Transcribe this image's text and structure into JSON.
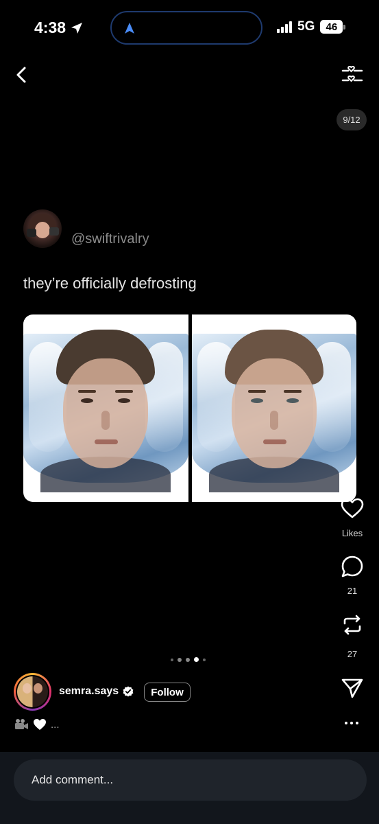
{
  "status_bar": {
    "time": "4:38",
    "network": "5G",
    "battery": "46"
  },
  "header": {
    "page_counter": "9/12"
  },
  "post": {
    "handle": "@swiftrivalry",
    "text": "they’re officially defrosting"
  },
  "actions": {
    "likes_label": "Likes",
    "comments_count": "21",
    "reposts_count": "27"
  },
  "carousel": {
    "total_dots": 5,
    "active_index": 3
  },
  "author": {
    "name": "semra.says",
    "follow_label": "Follow",
    "caption_ellipsis": "..."
  },
  "comment": {
    "placeholder": "Add comment..."
  },
  "colors": {
    "background": "#000000",
    "nav_arrow": "#4a8cf7",
    "comment_bar": "#12161c"
  },
  "icons": [
    "location-arrow-icon",
    "back-chevron-icon",
    "filter-icon",
    "heart-icon",
    "comment-icon",
    "repost-icon",
    "send-icon",
    "verified-icon",
    "video-camera-icon",
    "white-heart-icon",
    "more-icon"
  ]
}
